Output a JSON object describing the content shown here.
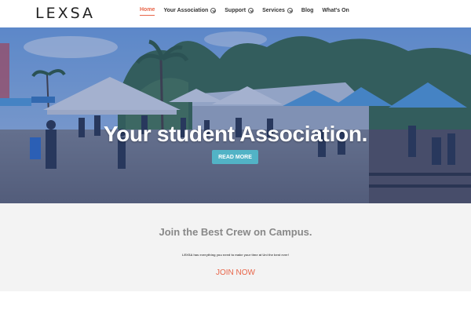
{
  "header": {
    "logo": "LEXSA",
    "nav": [
      {
        "label": "Home",
        "active": true,
        "dropdown": false
      },
      {
        "label": "Your Association",
        "active": false,
        "dropdown": true
      },
      {
        "label": "Support",
        "active": false,
        "dropdown": true
      },
      {
        "label": "Services",
        "active": false,
        "dropdown": true
      },
      {
        "label": "Blog",
        "active": false,
        "dropdown": false
      },
      {
        "label": "What's On",
        "active": false,
        "dropdown": false
      }
    ],
    "accent_color": "#e8664a"
  },
  "hero": {
    "title": "Your student Association.",
    "button_label": "READ MORE",
    "button_color": "#52b3c6"
  },
  "section": {
    "title": "Join the Best Crew on Campus.",
    "text": "LEXSA has everything you need to make your time at Uni the best ever!",
    "cta_label": "JOIN NOW"
  }
}
